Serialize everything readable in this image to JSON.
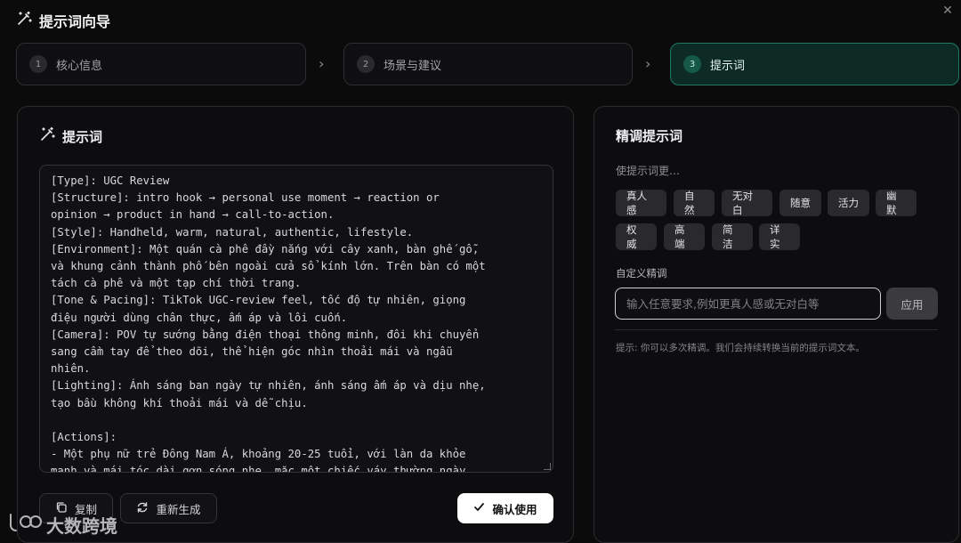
{
  "header": {
    "title": "提示词向导"
  },
  "steps": [
    {
      "num": "1",
      "label": "核心信息"
    },
    {
      "num": "2",
      "label": "场景与建议"
    },
    {
      "num": "3",
      "label": "提示词"
    }
  ],
  "left_panel": {
    "title": "提示词",
    "prompt_text": "[Type]: UGC Review\n[Structure]: intro hook → personal use moment → reaction or\nopinion → product in hand → call-to-action.\n[Style]: Handheld, warm, natural, authentic, lifestyle.\n[Environment]: Một quán cà phê đầy nắng với cây xanh, bàn ghế gỗ,\nvà khung cảnh thành phố bên ngoài cửa sổ kính lớn. Trên bàn có một\ntách cà phê và một tạp chí thời trang.\n[Tone & Pacing]: TikTok UGC-review feel, tốc độ tự nhiên, giọng\nđiệu người dùng chân thực, ấm áp và lôi cuốn.\n[Camera]: POV tự sướng bằng điện thoại thông minh, đôi khi chuyển\nsang cầm tay để theo dõi, thể hiện góc nhìn thoải mái và ngẫu\nnhiên.\n[Lighting]: Ánh sáng ban ngày tự nhiên, ánh sáng ấm áp và dịu nhẹ,\ntạo bầu không khí thoải mái và dễ chịu.\n\n[Actions]:\n- Một phụ nữ trẻ Đông Nam Á, khoảng 20-25 tuổi, với làn da khỏe\nmạnh và mái tóc dài gợn sóng nhẹ, mặc một chiếc váy thường ngày",
    "copy_label": "复制",
    "regenerate_label": "重新生成",
    "confirm_label": "确认使用"
  },
  "right_panel": {
    "title": "精调提示词",
    "subtitle": "使提示词更…",
    "chips_row1": [
      "真人感",
      "自然",
      "无对白",
      "随意",
      "活力",
      "幽默"
    ],
    "chips_row2": [
      "权威",
      "高端",
      "简洁",
      "详实"
    ],
    "custom_label": "自定义精调",
    "custom_placeholder": "输入任意要求,例如更真人感或无对白等",
    "apply_label": "应用",
    "hint": "提示: 你可以多次精调。我们会持续转换当前的提示词文本。"
  },
  "watermark": {
    "text": "大数跨境"
  },
  "colors": {
    "accent": "#1f7a63",
    "active_bg": "#0d2a24",
    "background": "#0b0b0c"
  }
}
